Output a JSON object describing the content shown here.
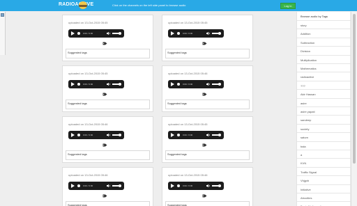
{
  "header": {
    "brand": "RADIOACTIVE",
    "instruction": "Click on the channels on the left side panel to browse audio",
    "login_label": "Log in"
  },
  "cards": [
    {
      "date": "uploaded on 13-Oct-2015 05:45",
      "time": "0:00 / 0:00",
      "tags_label": "Suggested tags"
    },
    {
      "date": "uploaded on 13-Oct-2015 05:45",
      "time": "0:00 / 0:00",
      "tags_label": "Suggested tags"
    },
    {
      "date": "uploaded on 13-Oct-2015 05:45",
      "time": "0:00 / 0:00",
      "tags_label": "Suggested tags"
    },
    {
      "date": "uploaded on 13-Oct-2015 05:46",
      "time": "0:00 / 0:00",
      "tags_label": "Suggested tags"
    },
    {
      "date": "uploaded on 13-Oct-2015 05:46",
      "time": "0:00 / 0:00",
      "tags_label": "Suggested tags"
    },
    {
      "date": "uploaded on 13-Oct-2015 05:45",
      "time": "0:00 / 0:00",
      "tags_label": "Suggested tags"
    },
    {
      "date": "uploaded on 13-Oct-2015 05:46",
      "time": "0:00 / 0:00",
      "tags_label": "Suggested tags"
    },
    {
      "date": "uploaded on 13-Oct-2015 05:46",
      "time": "0:00 / 0:00",
      "tags_label": "Suggested tags"
    }
  ],
  "sidebar": {
    "title": "Browse audio by Tags",
    "tags": [
      "story",
      "Addition",
      "Subtraction",
      "Division",
      "Multiplication",
      "Mathematics",
      "radioactive",
      "???",
      "Akir Hassan",
      "asire",
      "asire yapati",
      "sandeep",
      "society",
      "saturn",
      "bala",
      "a",
      "KVN",
      "Traffic Signal",
      "Vhjgvb",
      "Initiative",
      "Atrocities",
      "Basic Mathematics"
    ]
  },
  "icons": {
    "logo": "radio-logo-icon",
    "play": "play-icon",
    "volume": "volume-icon",
    "tag": "tag-icon",
    "menu": "menu-icon"
  },
  "colors": {
    "header": "#29a9e6",
    "login_button": "#39b54a",
    "player": "#1c1c1c"
  }
}
